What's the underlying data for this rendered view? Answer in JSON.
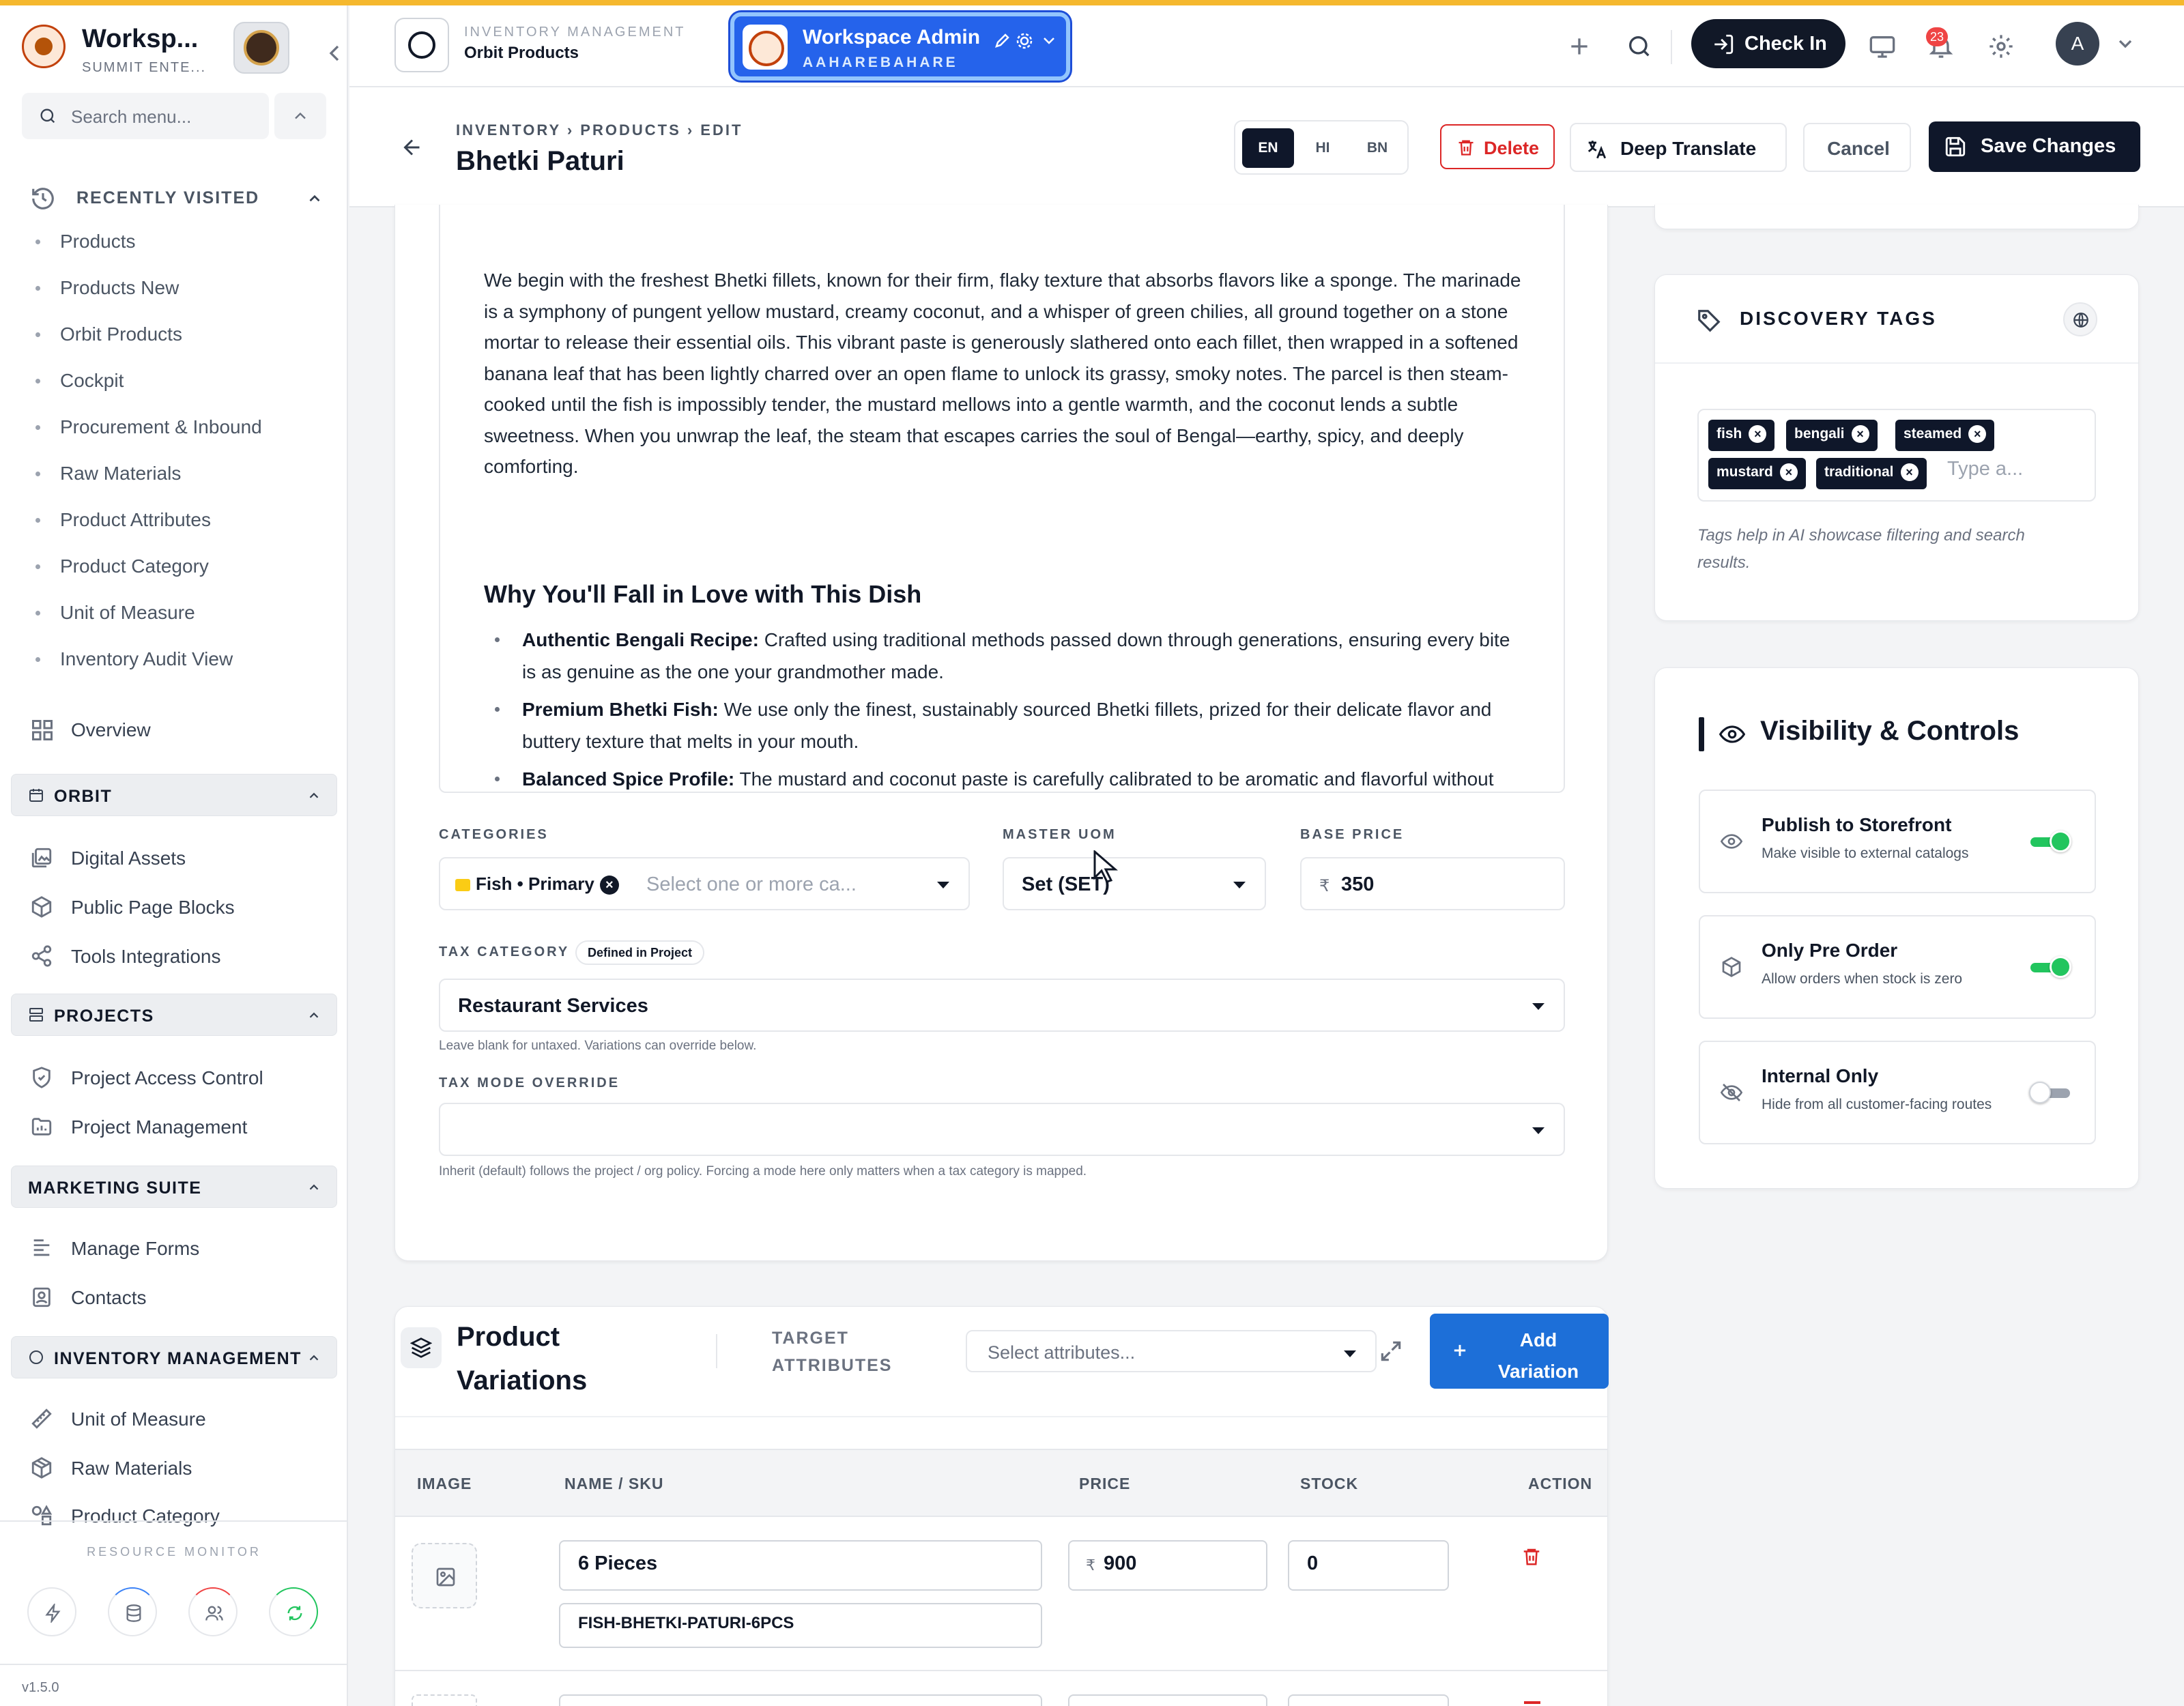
{
  "sidebar": {
    "brand_name": "Worksp...",
    "brand_sub": "SUMMIT ENTE...",
    "search_placeholder": "Search menu...",
    "recent": {
      "title": "RECENTLY VISITED",
      "items": [
        "Products",
        "Products New",
        "Orbit Products",
        "Cockpit",
        "Procurement & Inbound",
        "Raw Materials",
        "Product Attributes",
        "Product Category",
        "Unit of Measure",
        "Inventory Audit View"
      ]
    },
    "overview": "Overview",
    "sections": [
      {
        "title": "ORBIT",
        "items": [
          "Digital Assets",
          "Public Page Blocks",
          "Tools Integrations"
        ]
      },
      {
        "title": "PROJECTS",
        "items": [
          "Project Access Control",
          "Project Management"
        ]
      },
      {
        "title": "MARKETING SUITE",
        "items": [
          "Manage Forms",
          "Contacts"
        ]
      },
      {
        "title": "INVENTORY MANAGEMENT",
        "items": [
          "Unit of Measure",
          "Raw Materials",
          "Product Category"
        ]
      }
    ],
    "resource_monitor": "RESOURCE MONITOR",
    "version": "v1.5.0"
  },
  "topbar": {
    "module_sub": "INVENTORY MANAGEMENT",
    "module_title": "Orbit Products",
    "workspace_title": "Workspace Admin",
    "workspace_sub": "AAHAREBAHARE",
    "checkin": "Check In",
    "notifications": "23",
    "avatar": "A"
  },
  "subheader": {
    "breadcrumb": "INVENTORY › PRODUCTS › EDIT",
    "title": "Bhetki Paturi",
    "languages": [
      "EN",
      "HI",
      "BN"
    ],
    "active_language": "EN",
    "delete": "Delete",
    "deep_translate": "Deep Translate",
    "cancel": "Cancel",
    "save": "Save Changes"
  },
  "editor": {
    "paragraph": "We begin with the freshest Bhetki fillets, known for their firm, flaky texture that absorbs flavors like a sponge. The marinade is a symphony of pungent yellow mustard, creamy coconut, and a whisper of green chilies, all ground together on a stone mortar to release their essential oils. This vibrant paste is generously slathered onto each fillet, then wrapped in a softened banana leaf that has been lightly charred over an open flame to unlock its grassy, smoky notes. The parcel is then steam-cooked until the fish is impossibly tender, the mustard mellows into a gentle warmth, and the coconut lends a subtle sweetness. When you unwrap the leaf, the steam that escapes carries the soul of Bengal—earthy, spicy, and deeply comforting.",
    "heading": "Why You'll Fall in Love with This Dish",
    "bullets": [
      {
        "bold": "Authentic Bengali Recipe:",
        "text": " Crafted using traditional methods passed down through generations, ensuring every bite is as genuine as the one your grandmother made."
      },
      {
        "bold": "Premium Bhetki Fish:",
        "text": " We use only the finest, sustainably sourced Bhetki fillets, prized for their delicate flavor and buttery texture that melts in your mouth."
      },
      {
        "bold": "Balanced Spice Profile:",
        "text": " The mustard and coconut paste is carefully calibrated to be aromatic and flavorful without"
      }
    ]
  },
  "form": {
    "categories_label": "CATEGORIES",
    "category_chip": "Fish • Primary",
    "categories_placeholder": "Select one or more ca...",
    "uom_label": "MASTER UOM",
    "uom_value": "Set (SET)",
    "price_label": "BASE PRICE",
    "currency": "₹",
    "price_value": "350",
    "tax_label": "TAX CATEGORY",
    "tax_badge": "Defined in Project",
    "tax_value": "Restaurant Services",
    "tax_hint": "Leave blank for untaxed. Variations can override below.",
    "tax_mode_label": "TAX MODE OVERRIDE",
    "tax_mode_value": "",
    "tax_mode_hint": "Inherit (default) follows the project / org policy. Forcing a mode here only matters when a tax category is mapped."
  },
  "variations": {
    "title": "Product Variations",
    "target": "TARGET ATTRIBUTES",
    "attr_placeholder": "Select attributes...",
    "add": "Add Variation",
    "columns": [
      "IMAGE",
      "NAME / SKU",
      "PRICE",
      "STOCK",
      "ACTION"
    ],
    "rows": [
      {
        "name": "6 Pieces",
        "sku": "FISH-BHETKI-PATURI-6PCS",
        "currency": "₹",
        "price": "900",
        "stock": "0"
      }
    ]
  },
  "tags": {
    "title": "DISCOVERY TAGS",
    "items": [
      "fish",
      "bengali",
      "steamed",
      "mustard",
      "traditional"
    ],
    "input_placeholder": "Type a...",
    "hint": "Tags help in AI showcase filtering and search results."
  },
  "visibility": {
    "title": "Visibility & Controls",
    "rows": [
      {
        "title": "Publish to Storefront",
        "desc": "Make visible to external catalogs",
        "on": true
      },
      {
        "title": "Only Pre Order",
        "desc": "Allow orders when stock is zero",
        "on": true
      },
      {
        "title": "Internal Only",
        "desc": "Hide from all customer-facing routes",
        "on": false
      }
    ]
  },
  "colors": {
    "accent": "#2563eb",
    "dark": "#0f172a",
    "danger": "#dc2626",
    "success": "#22c55e",
    "top_strip": "#f5b82e"
  }
}
